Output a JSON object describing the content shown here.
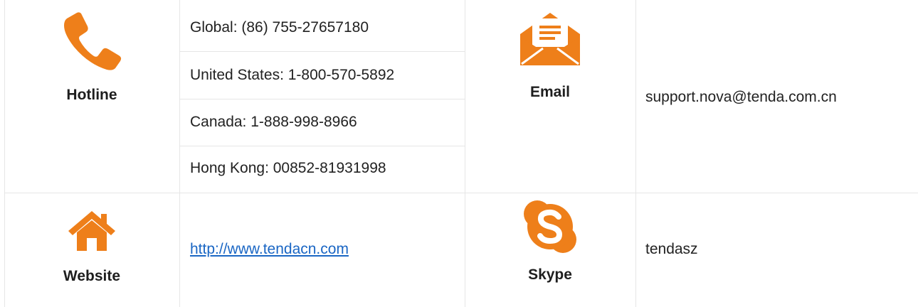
{
  "hotline": {
    "label": "Hotline",
    "numbers": [
      "Global: (86) 755-27657180",
      "United States: 1-800-570-5892",
      "Canada: 1-888-998-8966",
      "Hong Kong: 00852-81931998"
    ]
  },
  "email": {
    "label": "Email",
    "address": "support.nova@tenda.com.cn"
  },
  "website": {
    "label": "Website",
    "url": "http://www.tendacn.com"
  },
  "skype": {
    "label": "Skype",
    "id": "tendasz"
  },
  "colors": {
    "icon_orange": "#ee7f1a",
    "link_blue": "#1a66c4",
    "grid": "#e6e6e6"
  },
  "icons": {
    "hotline": "phone-icon",
    "email": "envelope-icon",
    "website": "home-icon",
    "skype": "skype-icon"
  }
}
